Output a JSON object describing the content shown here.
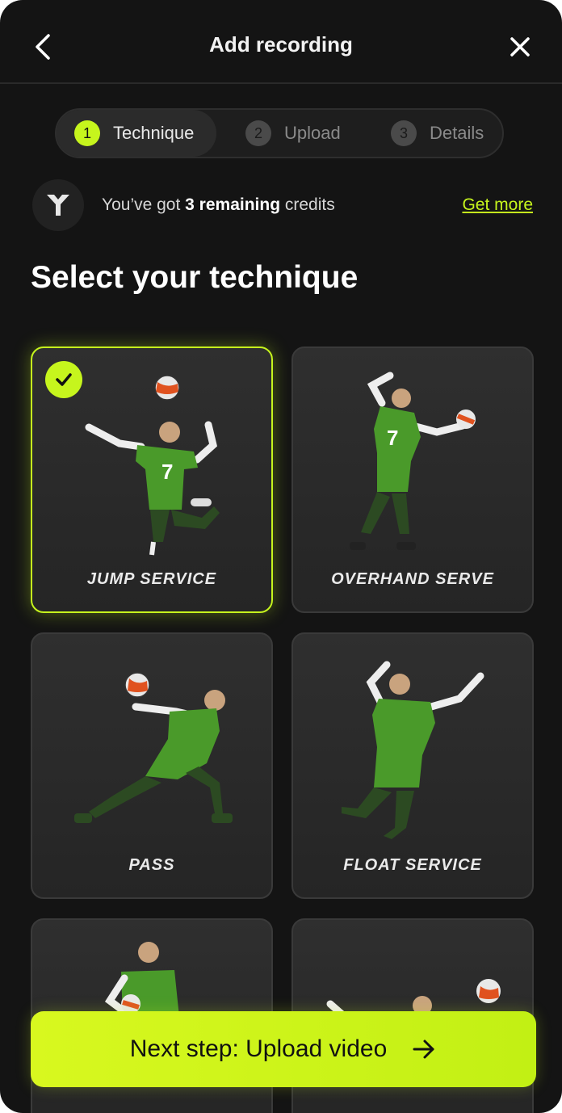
{
  "header": {
    "title": "Add recording"
  },
  "stepper": {
    "steps": [
      {
        "number": "1",
        "label": "Technique"
      },
      {
        "number": "2",
        "label": "Upload"
      },
      {
        "number": "3",
        "label": "Details"
      }
    ]
  },
  "credits": {
    "prefix": "You’ve got ",
    "bold": "3 remaining",
    "suffix": " credits",
    "link": "Get more"
  },
  "heading": "Select your technique",
  "techniques": [
    {
      "label": "JUMP SERVICE",
      "selected": true
    },
    {
      "label": "OVERHAND SERVE",
      "selected": false
    },
    {
      "label": "PASS",
      "selected": false
    },
    {
      "label": "FLOAT SERVICE",
      "selected": false
    },
    {
      "label": "",
      "selected": false
    },
    {
      "label": "",
      "selected": false
    }
  ],
  "cta": {
    "label": "Next step: Upload video"
  },
  "colors": {
    "accent": "#c6f51d",
    "background": "#141414",
    "card": "#2b2b2b"
  }
}
